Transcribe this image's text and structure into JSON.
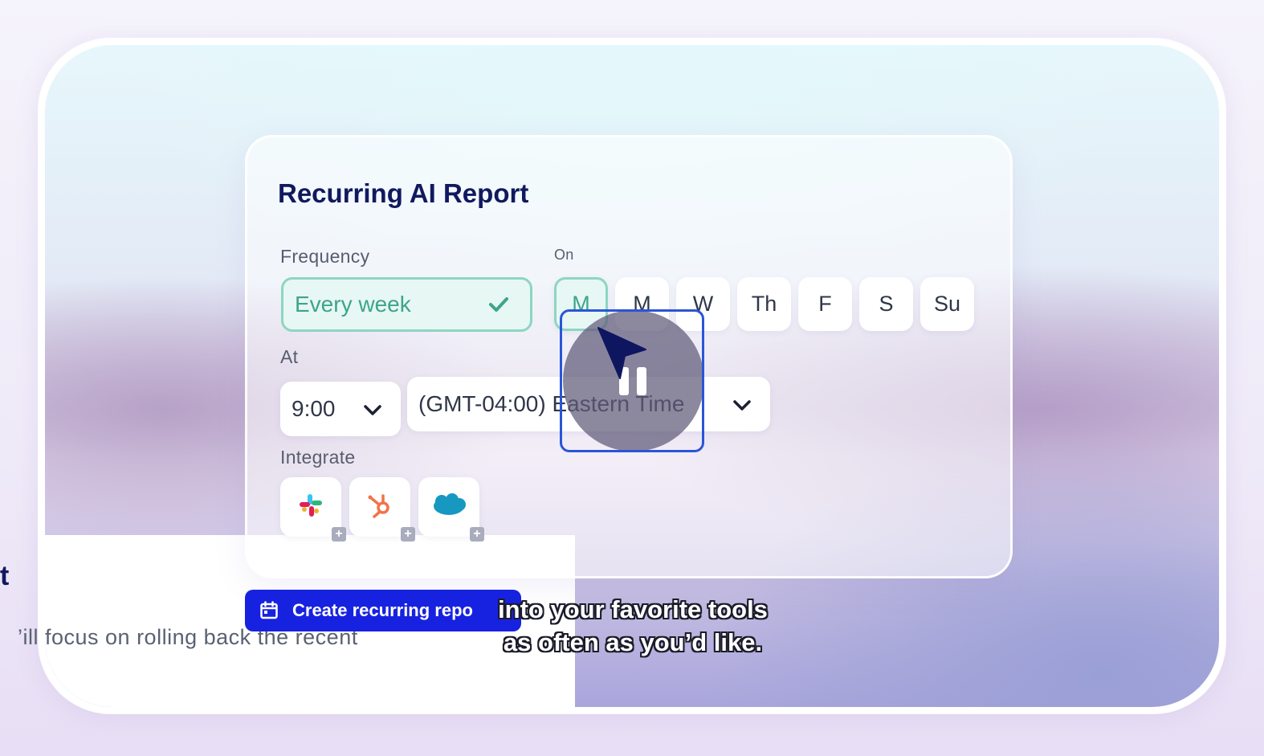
{
  "report": {
    "title": "Recurring AI Report",
    "frequency": {
      "label": "Frequency",
      "value": "Every week",
      "icon": "check-icon"
    },
    "on": {
      "label": "On",
      "days": [
        {
          "label": "M",
          "selected": true
        },
        {
          "label": "M",
          "selected": false
        },
        {
          "label": "W",
          "selected": false
        },
        {
          "label": "Th",
          "selected": false
        },
        {
          "label": "F",
          "selected": false
        },
        {
          "label": "S",
          "selected": false
        },
        {
          "label": "Su",
          "selected": false
        }
      ]
    },
    "at": {
      "label": "At",
      "time": "9:00",
      "timezone": "(GMT-04:00) Eastern Time"
    },
    "integrate": {
      "label": "Integrate",
      "items": [
        {
          "name": "Slack",
          "icon": "slack-icon"
        },
        {
          "name": "HubSpot",
          "icon": "hubspot-icon"
        },
        {
          "name": "Salesforce",
          "icon": "salesforce-icon"
        }
      ]
    },
    "create_button": "Create recurring repo"
  },
  "background_doc": {
    "heading_fragment": "t",
    "text_fragment": "’ill focus on rolling back the recent"
  },
  "caption": {
    "line1": "into your favorite tools",
    "line2": "as often as you’d like."
  },
  "colors": {
    "accent_blue": "#1722e0",
    "selected_green": "#3ca58a",
    "title_navy": "#11195e"
  }
}
